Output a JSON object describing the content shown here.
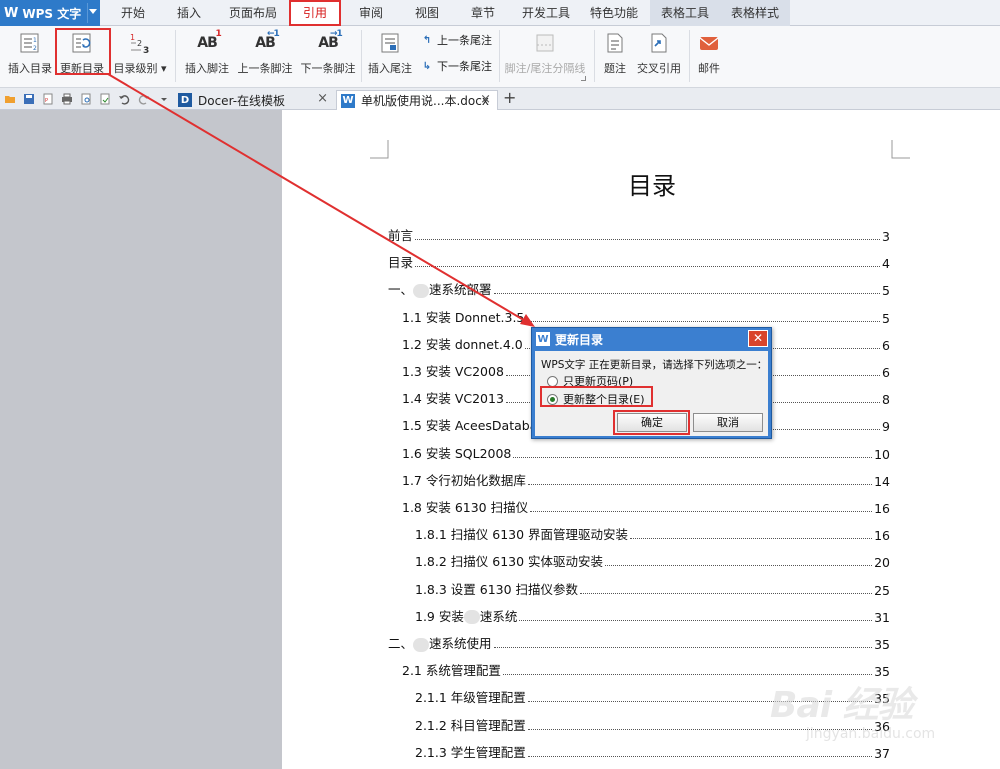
{
  "app": {
    "name": "WPS 文字"
  },
  "menu": {
    "tabs": [
      "开始",
      "插入",
      "页面布局",
      "引用",
      "审阅",
      "视图",
      "章节",
      "开发工具",
      "特色功能",
      "表格工具",
      "表格样式"
    ],
    "active_tab": "引用"
  },
  "ribbon": {
    "insert_toc": "插入目录",
    "update_toc": "更新目录",
    "toc_level": "目录级别",
    "insert_footnote": "插入脚注",
    "prev_footnote": "上一条脚注",
    "next_footnote": "下一条脚注",
    "insert_endnote": "插入尾注",
    "prev_endnote": "上一条尾注",
    "next_endnote": "下一条尾注",
    "separator": "脚注/尾注分隔线",
    "caption": "题注",
    "cross_ref": "交叉引用",
    "mail": "邮件"
  },
  "tabs": {
    "docer": "Docer-在线模板",
    "document": "单机版使用说...本.docx",
    "close": "×",
    "new": "+"
  },
  "document": {
    "title": "目录",
    "toc": [
      {
        "text": "前言",
        "page": "3",
        "level": 0
      },
      {
        "text": "目录",
        "page": "4",
        "level": 0
      },
      {
        "text": "一、",
        "text2": "速系统部署",
        "page": "5",
        "level": 0,
        "blur": true
      },
      {
        "text": "1.1 安装 Donnet.3.5",
        "page": "5",
        "level": 1
      },
      {
        "text": "1.2 安装 donnet.4.0",
        "page": "6",
        "level": 1
      },
      {
        "text": "1.3 安装 VC2008",
        "page": "6",
        "level": 1
      },
      {
        "text": "1.4 安装 VC2013",
        "page": "8",
        "level": 1
      },
      {
        "text": "1.5 安装 AceesDatabase",
        "page": "9",
        "level": 1
      },
      {
        "text": "1.6 安装 SQL2008",
        "page": "10",
        "level": 1
      },
      {
        "text": "1.7 令行初始化数据库",
        "page": "14",
        "level": 1
      },
      {
        "text": "1.8 安装 6130 扫描仪",
        "page": "16",
        "level": 1
      },
      {
        "text": "1.8.1 扫描仪 6130 界面管理驱动安装",
        "page": "16",
        "level": 2
      },
      {
        "text": "1.8.2 扫描仪 6130 实体驱动安装",
        "page": "20",
        "level": 2
      },
      {
        "text": "1.8.3 设置 6130 扫描仪参数",
        "page": "25",
        "level": 2
      },
      {
        "text": "1.9 安装",
        "text2": "速系统",
        "page": "31",
        "level": 2,
        "blur": true
      },
      {
        "text": "二、",
        "text2": "速系统使用",
        "page": "35",
        "level": 0,
        "blur": true
      },
      {
        "text": "2.1 系统管理配置",
        "page": "35",
        "level": 1
      },
      {
        "text": "2.1.1 年级管理配置",
        "page": "35",
        "level": 2
      },
      {
        "text": "2.1.2 科目管理配置",
        "page": "36",
        "level": 2
      },
      {
        "text": "2.1.3 学生管理配置",
        "page": "37",
        "level": 2
      }
    ]
  },
  "dialog": {
    "title": "更新目录",
    "message": "WPS文字 正在更新目录，请选择下列选项之一：",
    "option1": "只更新页码(P)",
    "option2": "更新整个目录(E)",
    "selected": "option2",
    "ok": "确定",
    "cancel": "取消"
  },
  "watermark": {
    "main": "Bai 经验",
    "sub": "jingyan.baidu.com"
  },
  "colors": {
    "brand": "#2e7ac9",
    "highlight": "#e03030",
    "dialog_title": "#3b7fd0"
  }
}
